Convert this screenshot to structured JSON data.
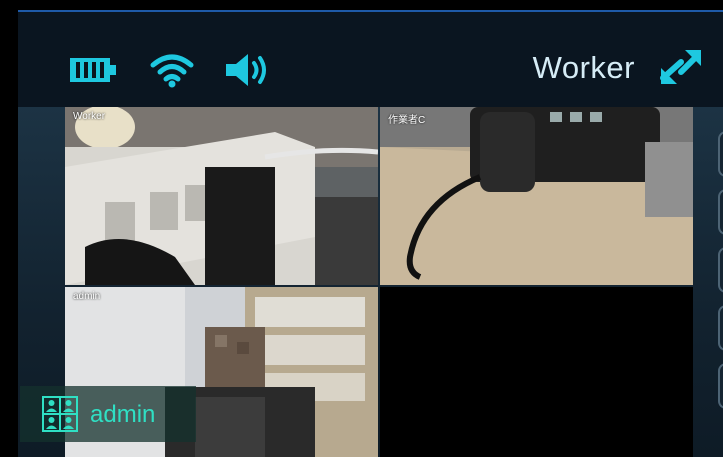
{
  "status": {
    "battery_icon": "battery-icon",
    "wifi_icon": "wifi-icon",
    "volume_icon": "speaker-volume-icon",
    "role": "Worker",
    "swap_icon": "swap-arrows-icon"
  },
  "videos": [
    {
      "label": "Worker"
    },
    {
      "label": "作業者C"
    },
    {
      "label": "admin"
    }
  ],
  "user_bar": {
    "icon": "participants-icon",
    "name": "admin"
  },
  "colors": {
    "accent": "#1ec8e0",
    "user_name": "#2fe0c4",
    "top_border": "#1e5aa8"
  }
}
